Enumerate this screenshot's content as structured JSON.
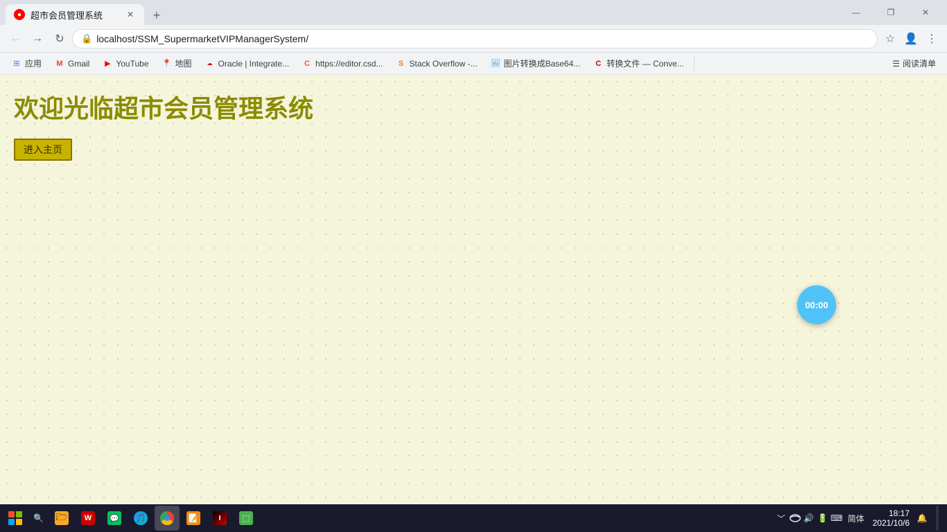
{
  "browser": {
    "tab": {
      "title": "超市会员管理系统",
      "favicon_color": "#4CAF50"
    },
    "address": "localhost/SSM_SupermarketVIPManagerSystem/",
    "window_controls": {
      "minimize": "—",
      "maximize": "❐",
      "close": "✕"
    }
  },
  "bookmarks": {
    "items": [
      {
        "label": "应用",
        "icon": "⊞",
        "color": "#4285f4"
      },
      {
        "label": "Gmail",
        "icon": "M",
        "color": "#ea4335"
      },
      {
        "label": "YouTube",
        "icon": "▶",
        "color": "#ff0000"
      },
      {
        "label": "地图",
        "icon": "📍",
        "color": "#34a853"
      },
      {
        "label": "Oracle | Integrate...",
        "icon": "☁",
        "color": "#cc0000"
      },
      {
        "label": "https://editor.csd...",
        "icon": "C",
        "color": "#fc5531"
      },
      {
        "label": "Stack Overflow -...",
        "icon": "S",
        "color": "#f48024"
      },
      {
        "label": "图片转换成Base64...",
        "icon": "🖼",
        "color": "#2196f3"
      },
      {
        "label": "转换文件 — Conve...",
        "icon": "C",
        "color": "#cc0000"
      }
    ],
    "reading_list": "阅读清单"
  },
  "page": {
    "heading": "欢迎光临超市会员管理系统",
    "enter_button": "进入主页",
    "timer": "00:00",
    "background_color": "#f5f5dc"
  },
  "taskbar": {
    "items": [
      {
        "name": "file-explorer",
        "color": "#f9a825",
        "icon": "🗁",
        "label": "文件资源管理器"
      },
      {
        "name": "wps",
        "color": "#cc0000",
        "icon": "W",
        "label": "WPS"
      },
      {
        "name": "wechat",
        "color": "#07c160",
        "icon": "✆",
        "label": "微信"
      },
      {
        "name": "windows-media",
        "color": "#1a6b1a",
        "icon": "▶",
        "label": "Windows Media"
      },
      {
        "name": "chrome",
        "color": "#4285f4",
        "icon": "◉",
        "label": "Chrome"
      },
      {
        "name": "notepad",
        "color": "#ff8c00",
        "icon": "✎",
        "label": "记事本"
      },
      {
        "name": "intellij",
        "color": "#cc0000",
        "icon": "I",
        "label": "IntelliJ IDEA"
      },
      {
        "name": "app7",
        "color": "#4caf50",
        "icon": "🗔",
        "label": "应用"
      }
    ],
    "systray": {
      "chevron": "﹀",
      "network": "🌐",
      "volume": "🔊",
      "battery": "🔋",
      "keyboard": "⌨",
      "lang": "简体",
      "time": "18:17",
      "date": "2021/10/6"
    }
  }
}
